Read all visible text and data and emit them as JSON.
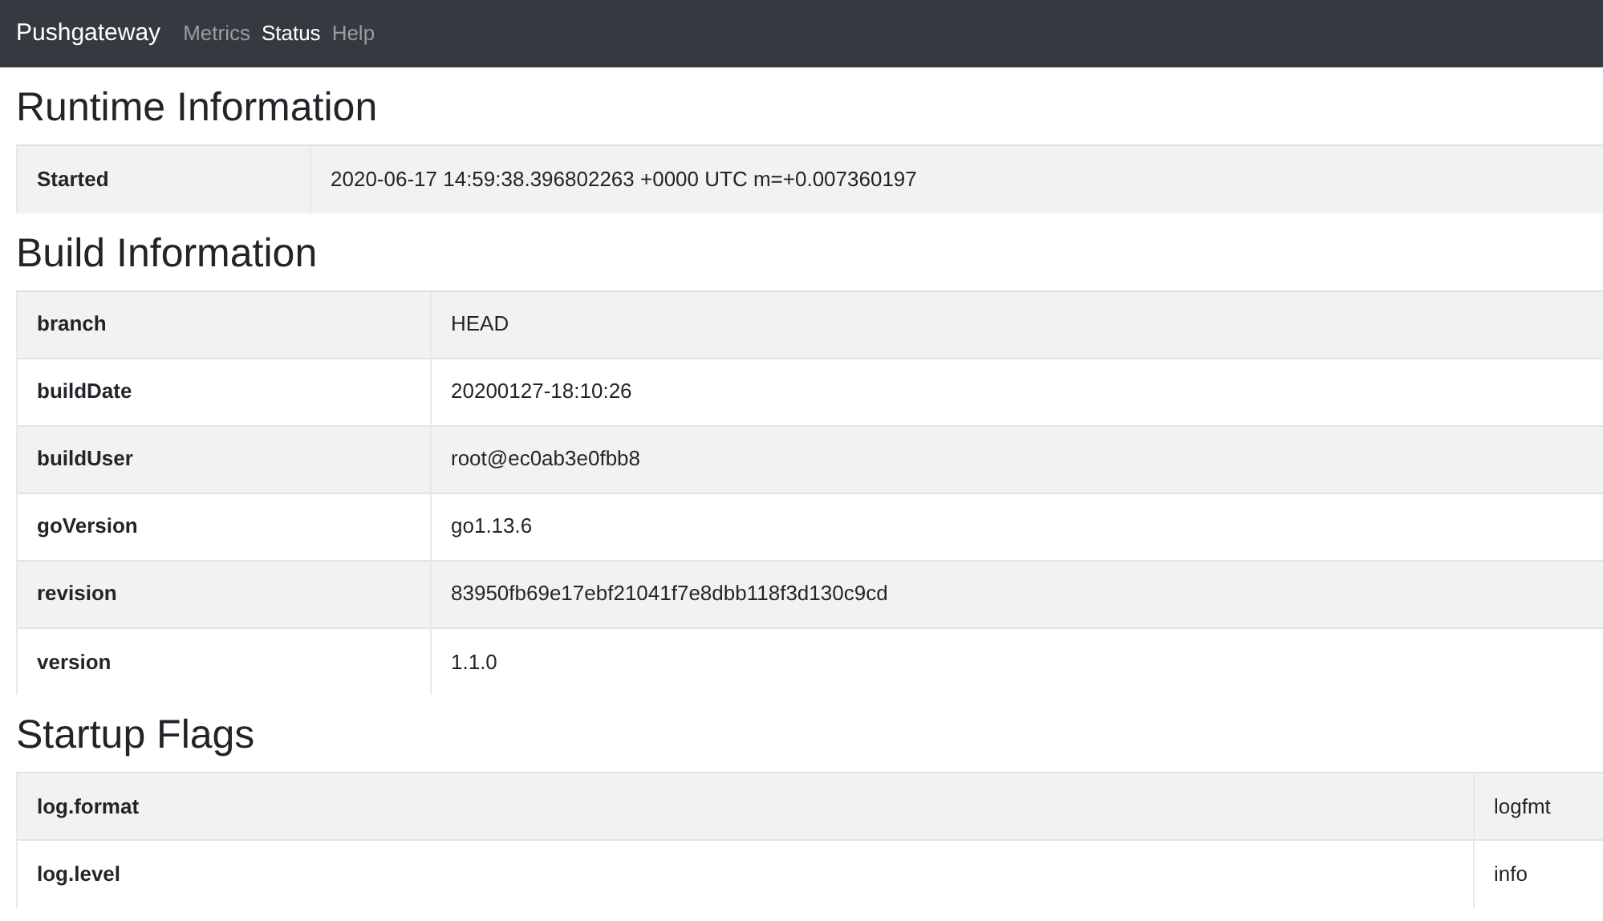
{
  "navbar": {
    "brand": "Pushgateway",
    "links": [
      {
        "label": "Metrics",
        "selected": false
      },
      {
        "label": "Status",
        "selected": true
      },
      {
        "label": "Help",
        "selected": false
      }
    ]
  },
  "sections": [
    {
      "title": "Runtime Information",
      "rows": [
        {
          "key": "Started",
          "value": "2020-06-17 14:59:38.396802263 +0000 UTC m=+0.007360197"
        }
      ]
    },
    {
      "title": "Build Information",
      "rows": [
        {
          "key": "branch",
          "value": "HEAD"
        },
        {
          "key": "buildDate",
          "value": "20200127-18:10:26"
        },
        {
          "key": "buildUser",
          "value": "root@ec0ab3e0fbb8"
        },
        {
          "key": "goVersion",
          "value": "go1.13.6"
        },
        {
          "key": "revision",
          "value": "83950fb69e17ebf21041f7e8dbb118f3d130c9cd"
        },
        {
          "key": "version",
          "value": "1.1.0"
        }
      ]
    },
    {
      "title": "Startup Flags",
      "rows": [
        {
          "key": "log.format",
          "value": "logfmt"
        },
        {
          "key": "log.level",
          "value": "info"
        }
      ]
    }
  ]
}
